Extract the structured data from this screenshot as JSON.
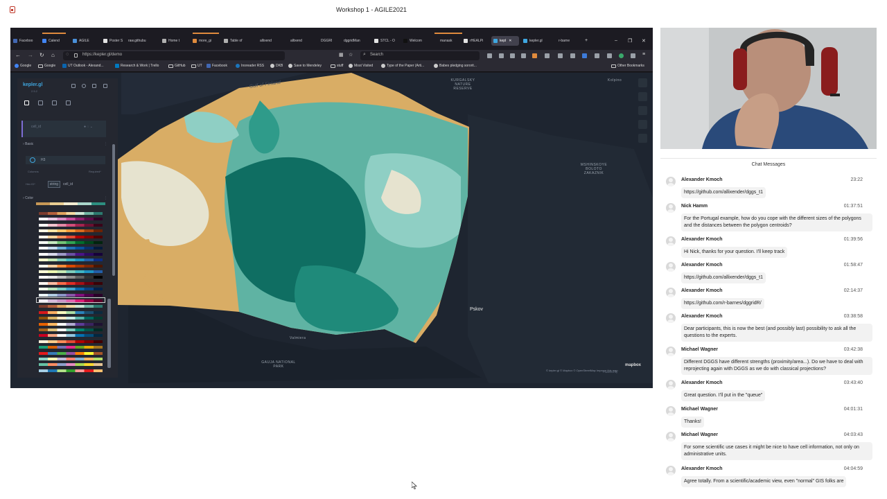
{
  "window": {
    "title": "Workshop 1 - AGILE2021"
  },
  "browser": {
    "tabs": [
      {
        "label": "Faceboo"
      },
      {
        "label": "Calend"
      },
      {
        "label": "AGILE"
      },
      {
        "label": "Poster S"
      },
      {
        "label": "raw.githubu"
      },
      {
        "label": "Home t"
      },
      {
        "label": "more_gi"
      },
      {
        "label": "Table of"
      },
      {
        "label": "allixend"
      },
      {
        "label": "allixend"
      },
      {
        "label": "DGGRI"
      },
      {
        "label": "dggridMan"
      },
      {
        "label": "STCL - O"
      },
      {
        "label": "Welcom"
      },
      {
        "label": "manask"
      },
      {
        "label": "rHEALPi"
      },
      {
        "label": "kepl",
        "active": true
      },
      {
        "label": "kepler.gl"
      },
      {
        "label": "r-barne"
      }
    ],
    "new_tab": "+",
    "controls": {
      "minimize": "–",
      "maximize": "❐",
      "close": "✕"
    },
    "url": "https://kepler.gl/demo",
    "search_placeholder": "Search",
    "bookmarks": [
      {
        "label": "Google"
      },
      {
        "label": "Google",
        "folder": true
      },
      {
        "label": "UT Outlook - Alexand..."
      },
      {
        "label": "Research & Work | Trello"
      },
      {
        "label": "GitHub",
        "folder": true
      },
      {
        "label": "UT",
        "folder": true
      },
      {
        "label": "Facebook"
      },
      {
        "label": "Inoreader RSS"
      },
      {
        "label": "DKB"
      },
      {
        "label": "Save to Mendeley"
      },
      {
        "label": "stuff",
        "folder": true
      },
      {
        "label": "Most Visited"
      },
      {
        "label": "Type of the Paper (Arti..."
      },
      {
        "label": "Babes pledging sororit..."
      }
    ],
    "other_bookmarks": "Other Bookmarks"
  },
  "kepler": {
    "logo": "kepler.gl",
    "version": "2.5.2",
    "layer_name": "cell_id",
    "section_basic": "Basic",
    "layer_type_label": "H3",
    "columns_label": "Columns",
    "required_label": "Required*",
    "hex_id_label": "Hex ID*",
    "field_type": "string",
    "field_name": "cell_id",
    "section_color": "Color"
  },
  "map": {
    "labels": {
      "gulf": "Gulf of Finland",
      "reserve": "KURGALSKY\nNATURE\nRESERVE",
      "kolpino": "Kolpino",
      "zakaznik": "MSHINSKOYE\nBOLOTO\nZAKAZNIK",
      "pskov": "Pskov",
      "valmiera": "Valmiera",
      "gauja": "GAUJA NATIONAL\nPARK"
    },
    "credits": "© kepler.gl © Mapbox © OpenStreetMap Improve this map",
    "powered_by": "Powered by",
    "mapbox": "mapbox"
  },
  "chat": {
    "title": "Chat Messages",
    "messages": [
      {
        "author": "Alexander Kmoch",
        "time": "23:22",
        "text": "https://github.com/allixender/dggs_t1"
      },
      {
        "author": "Nick Hamm",
        "time": "01:37:51",
        "text": "For the Portugal example, how do you cope with the different sizes of the polygons and the distances between the polygon centroids?"
      },
      {
        "author": "Alexander Kmoch",
        "time": "01:39:56",
        "text": "Hi Nick, thanks for your question. I'll keep track"
      },
      {
        "author": "Alexander Kmoch",
        "time": "01:58:47",
        "text": "https://github.com/allixender/dggs_t1"
      },
      {
        "author": "Alexander Kmoch",
        "time": "02:14:37",
        "text": "https://github.com/r-barnes/dggridR/"
      },
      {
        "author": "Alexander Kmoch",
        "time": "03:38:58",
        "text": "Dear participants, this is now the best (and possibly last) possibility to ask all the questions to the experts."
      },
      {
        "author": "Michael Wagner",
        "time": "03:42:38",
        "text": "Different DGGS have different strengths (proximity/area...). Do we have to deal with reprojecting again with DGGS as we do with classical projections?"
      },
      {
        "author": "Alexander Kmoch",
        "time": "03:43:40",
        "text": "Great question. I'll put in the \"queue\""
      },
      {
        "author": "Michael Wagner",
        "time": "04:01:31",
        "text": "Thanks!"
      },
      {
        "author": "Michael Wagner",
        "time": "04:03:43",
        "text": "For some scientific use cases it might be nice to have cell information, not only on administrative units."
      },
      {
        "author": "Alexander Kmoch",
        "time": "04:04:59",
        "text": "Agree totally. From a scientific/academic view, even \"normal\" GIS folks are"
      }
    ]
  },
  "colors": {
    "sand": "#d9ad65",
    "teal_dark": "#0f6e62",
    "teal_mid": "#2f9b8a",
    "teal_light": "#8fcfc4",
    "pale": "#e6e3cf",
    "map_bg": "#1e2530",
    "panel_bg": "#242730"
  }
}
